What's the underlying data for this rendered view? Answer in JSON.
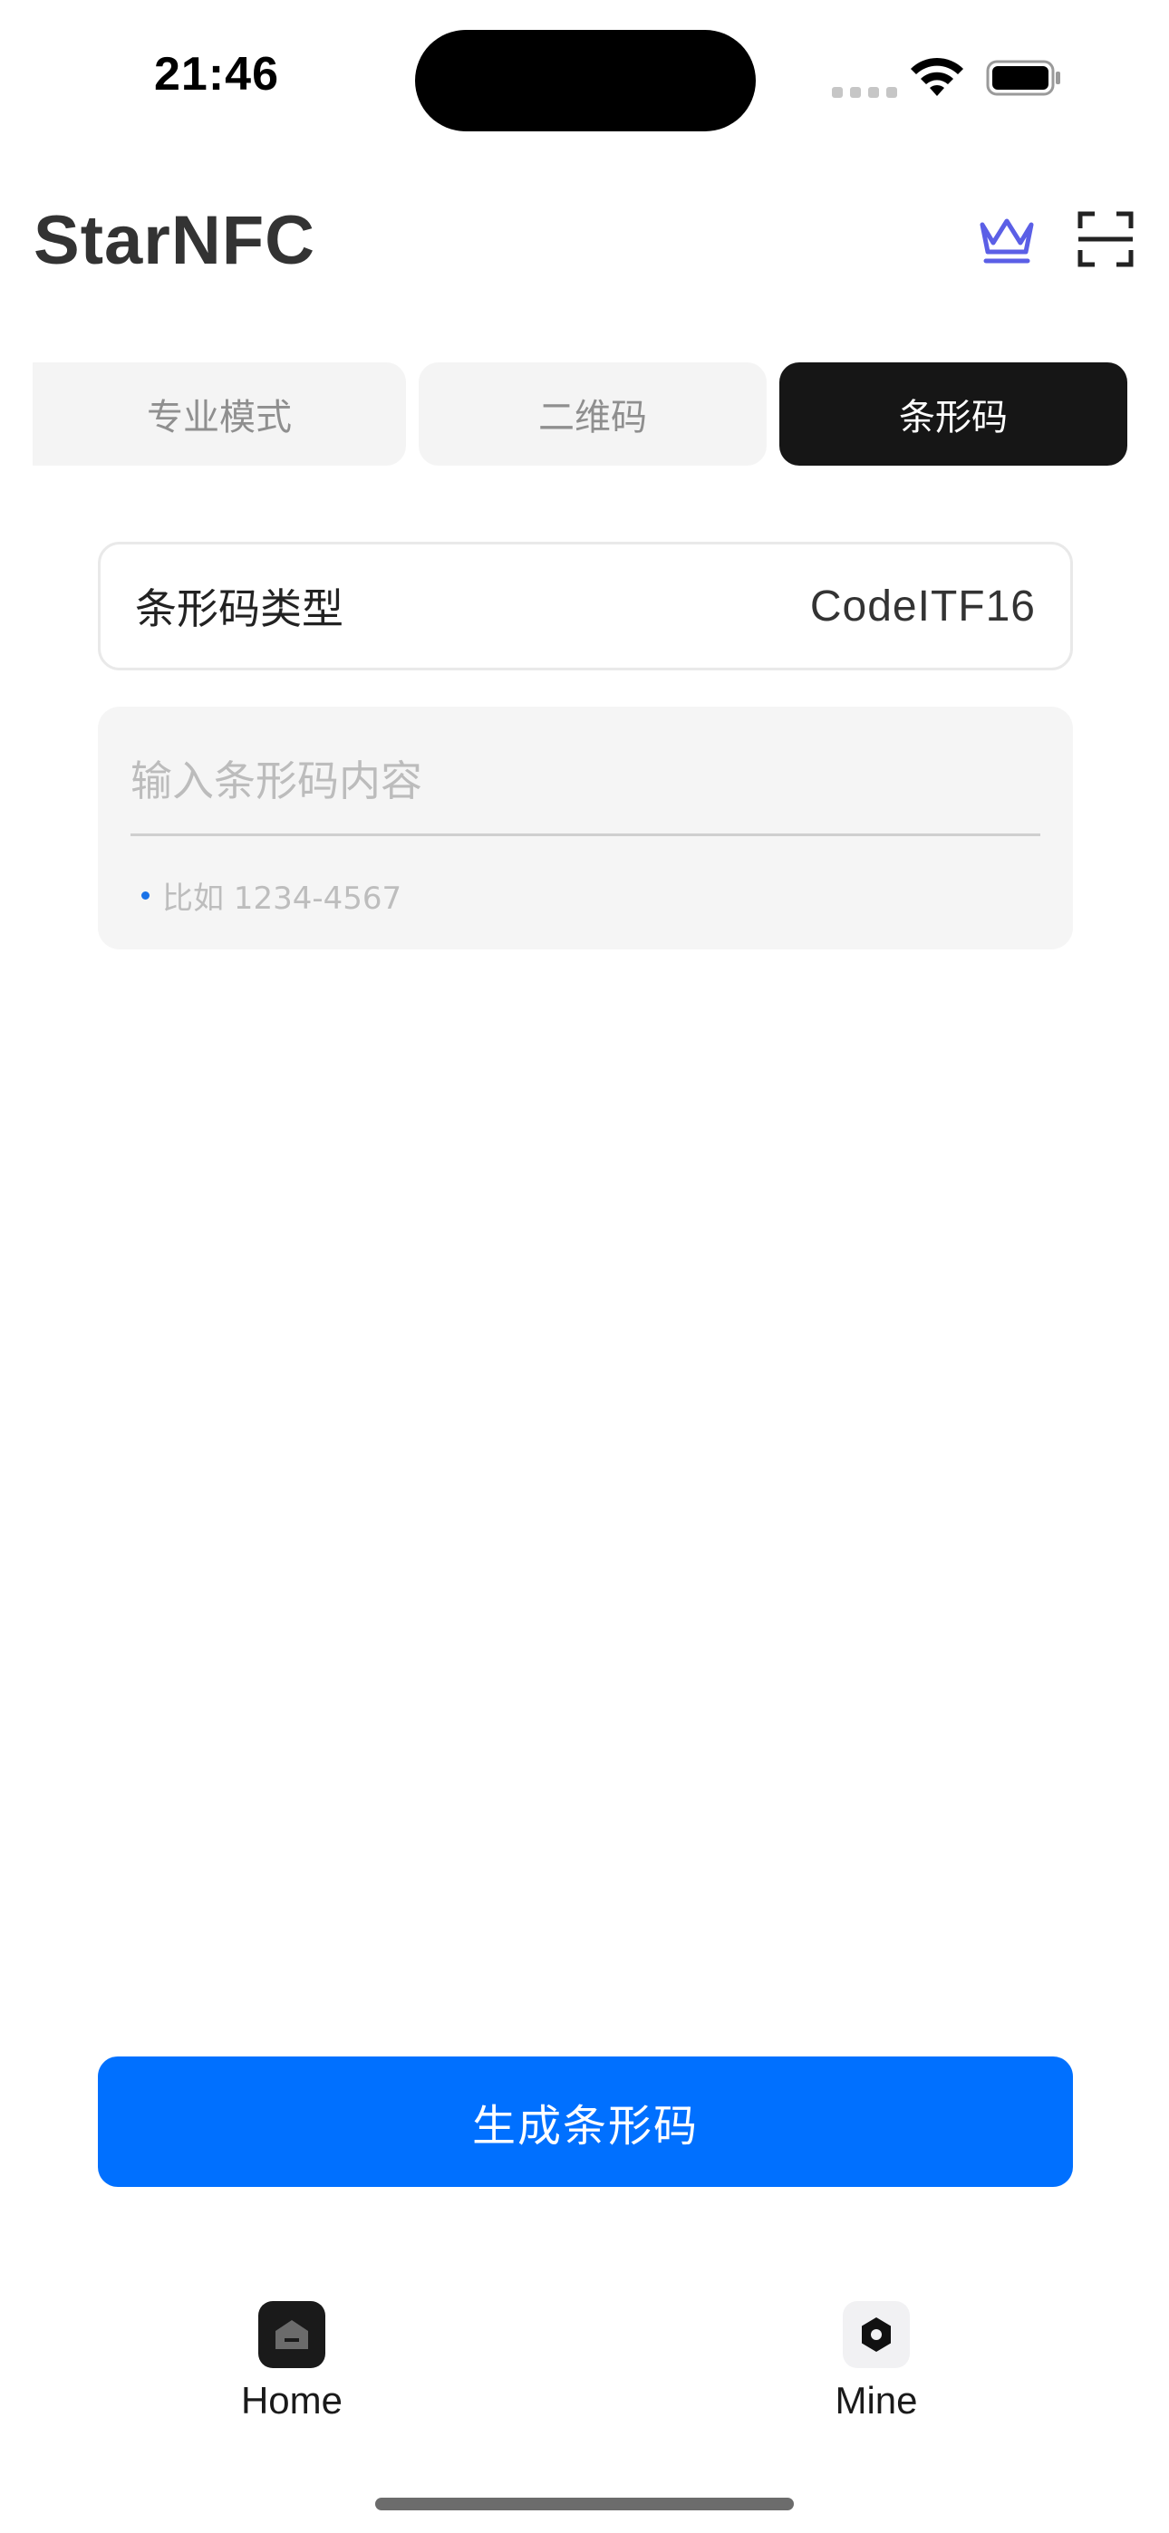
{
  "status_bar": {
    "time": "21:46"
  },
  "header": {
    "title": "StarNFC",
    "crown_icon": "crown-icon",
    "scan_icon": "scan-icon",
    "accent_color": "#5b5fe6"
  },
  "tabs": [
    {
      "label": "专业模式",
      "active": false
    },
    {
      "label": "二维码",
      "active": false
    },
    {
      "label": "条形码",
      "active": true
    }
  ],
  "barcode_type": {
    "label": "条形码类型",
    "value": "CodeITF16"
  },
  "content_input": {
    "placeholder": "输入条形码内容",
    "value": "",
    "hint": "比如 1234-4567"
  },
  "generate_button": {
    "label": "生成条形码",
    "color": "#0070ff"
  },
  "bottom_nav": {
    "items": [
      {
        "label": "Home",
        "icon": "home-icon",
        "active": true
      },
      {
        "label": "Mine",
        "icon": "settings-hex-icon",
        "active": false
      }
    ]
  }
}
